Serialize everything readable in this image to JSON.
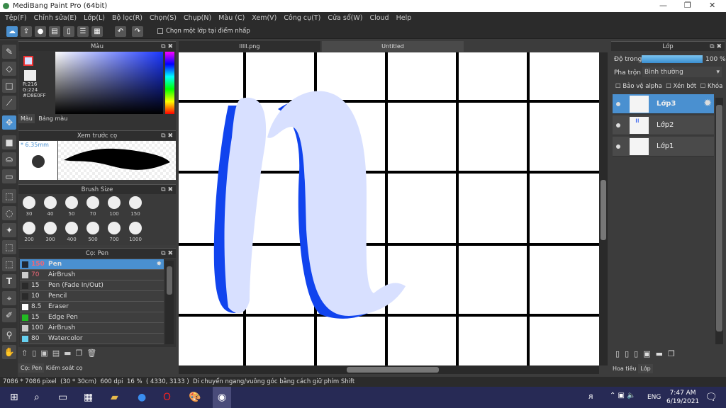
{
  "window": {
    "title": "MediBang Paint Pro (64bit)"
  },
  "menu": [
    "Tệp(F)",
    "Chỉnh sửa(E)",
    "Lớp(L)",
    "Bộ lọc(R)",
    "Chọn(S)",
    "Chụp(N)",
    "Màu (C)",
    "Xem(V)",
    "Công cụ(T)",
    "Cửa sổ(W)",
    "Cloud",
    "Help"
  ],
  "toolbar": {
    "select_layer_checkbox": "Chọn một lớp tại điểm nhấp"
  },
  "color_panel": {
    "title": "Màu",
    "r": "R:216",
    "g": "G:224",
    "hex": "#D8E0FF",
    "tabs": [
      "Màu",
      "Bảng màu"
    ],
    "current_color": "#D8E0FF"
  },
  "brush_preview": {
    "title": "Xem trước cọ",
    "size": "* 6.35mm"
  },
  "brush_size": {
    "title": "Brush Size",
    "sizes": [
      "30",
      "40",
      "50",
      "70",
      "100",
      "150",
      "200",
      "300",
      "400",
      "500",
      "700",
      "1000"
    ]
  },
  "brush_panel": {
    "title": "Cọ: Pen",
    "items": [
      {
        "size": "150",
        "name": "Pen",
        "color": "#222831",
        "selected": true
      },
      {
        "size": "70",
        "name": "AirBrush",
        "color": "#cccccc"
      },
      {
        "size": "15",
        "name": "Pen (Fade In/Out)",
        "color": "#2a2a2a"
      },
      {
        "size": "10",
        "name": "Pencil",
        "color": "#2a2a2a"
      },
      {
        "size": "8.5",
        "name": "Eraser",
        "color": "#ffffff"
      },
      {
        "size": "15",
        "name": "Edge Pen",
        "color": "#22bb22"
      },
      {
        "size": "100",
        "name": "AirBrush",
        "color": "#cccccc"
      },
      {
        "size": "80",
        "name": "Watercolor",
        "color": "#66d0f0"
      }
    ],
    "tabs": [
      "Cọ: Pen",
      "Kiểm soát cọ"
    ]
  },
  "doc_tabs": [
    "lllll.png",
    "Untitled"
  ],
  "layer_panel": {
    "title": "Lớp",
    "opacity_label": "Độ trong",
    "opacity_value": "100 %",
    "opacity": 100,
    "blend_label": "Pha trộn",
    "blend_value": "Bình thường",
    "options": [
      "Bảo vệ alpha",
      "Xén bớt",
      "Khóa"
    ],
    "layers": [
      "Lớp3",
      "Lớp2",
      "Lớp1"
    ],
    "tabs": [
      "Hoa tiêu",
      "Lớp"
    ]
  },
  "status": {
    "size": "7086 * 7086 pixel",
    "cm": "(30 * 30cm)",
    "dpi": "600 dpi",
    "zoom": "16 %",
    "coords": "( 4330, 3133 )",
    "hint": "Di chuyển ngang/vuông góc bằng cách giữ phím Shift"
  },
  "taskbar": {
    "lang": "ENG",
    "time": "7:47 AM",
    "date": "6/19/2021",
    "notifications": "1"
  }
}
